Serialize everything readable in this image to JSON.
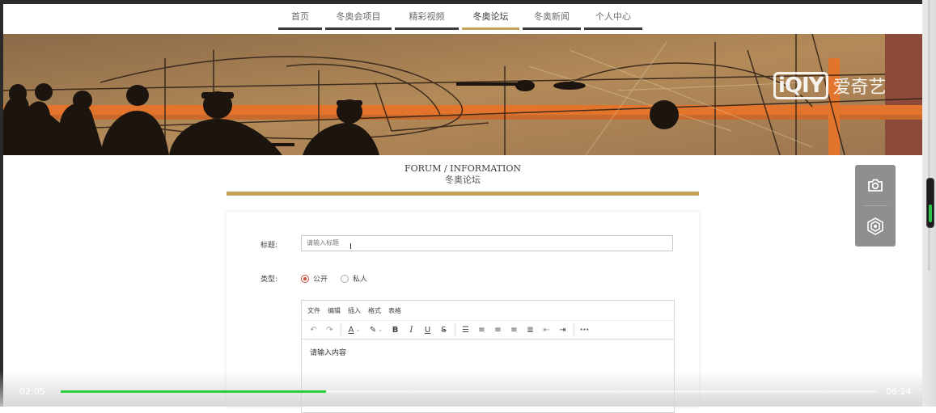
{
  "nav": {
    "items": [
      {
        "label": "首页",
        "active": false
      },
      {
        "label": "冬奥会项目",
        "active": false
      },
      {
        "label": "精彩视频",
        "active": false
      },
      {
        "label": "冬奥论坛",
        "active": true
      },
      {
        "label": "冬奥新闻",
        "active": false
      },
      {
        "label": "个人中心",
        "active": false
      }
    ]
  },
  "banner": {
    "logo_mark": "iQIY",
    "logo_text": "爱奇艺"
  },
  "section": {
    "title_en": "FORUM / INFORMATION",
    "title_zh": "冬奥论坛"
  },
  "form": {
    "title_label": "标题:",
    "title_placeholder": "请输入标题",
    "type_label": "类型:",
    "type_options": [
      {
        "label": "公开",
        "checked": true
      },
      {
        "label": "私人",
        "checked": false
      }
    ]
  },
  "editor": {
    "menu": [
      "文件",
      "编辑",
      "插入",
      "格式",
      "表格"
    ],
    "toolbar_icons": [
      "undo-icon",
      "redo-icon",
      "text-color-icon",
      "highlight-icon",
      "bold-icon",
      "italic-icon",
      "underline-icon",
      "strikethrough-icon",
      "list-icon",
      "align-left-icon",
      "align-center-icon",
      "align-right-icon",
      "justify-icon",
      "outdent-icon",
      "indent-icon",
      "more-icon"
    ],
    "body_text": "请输入内容"
  },
  "video": {
    "current_time": "02:05",
    "total_time": "06:24",
    "progress": 0.325
  },
  "colors": {
    "accent_gold": "#c4a259",
    "progress_green": "#2fcc3c",
    "radio_red": "#d04a3a"
  }
}
